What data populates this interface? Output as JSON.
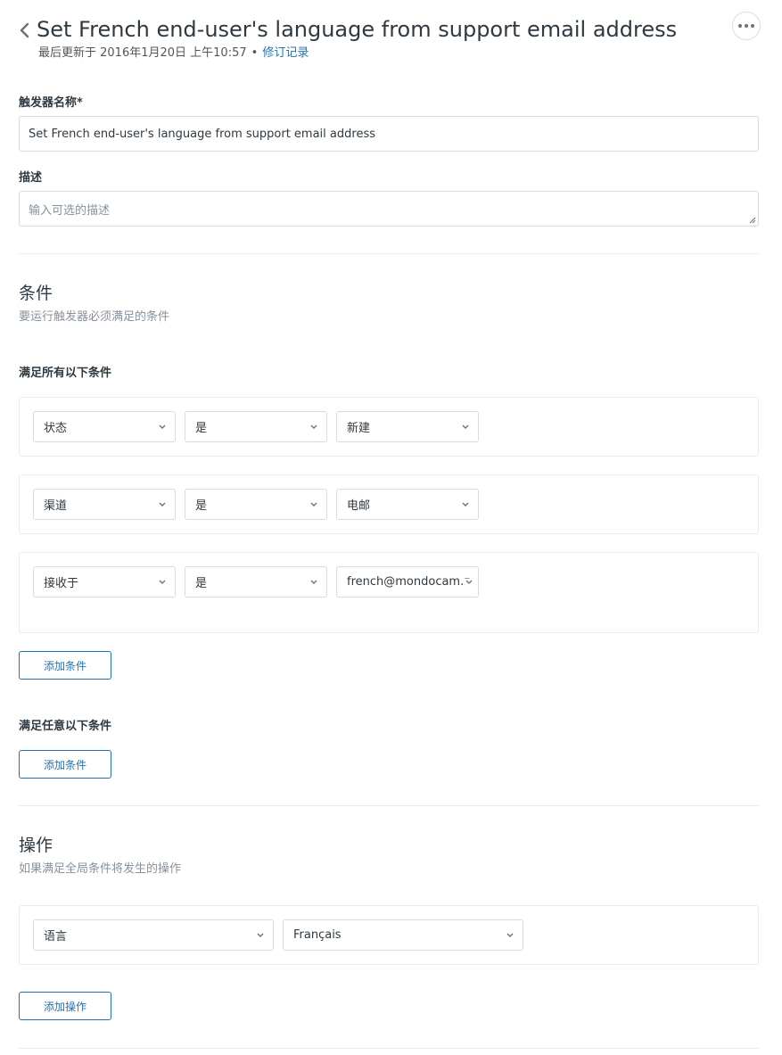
{
  "header": {
    "title": "Set French end-user's language from support email address",
    "updated_text": "最后更新于 2016年1月20日 上午10:57",
    "revisions_link": "修订记录"
  },
  "form": {
    "name_label": "触发器名称*",
    "name_value": "Set French end-user's language from support email address",
    "description_label": "描述",
    "description_placeholder": "输入可选的描述"
  },
  "conditions": {
    "title": "条件",
    "subtitle": "要运行触发器必须满足的条件",
    "all_label": "满足所有以下条件",
    "all_rows": [
      {
        "field": "状态",
        "operator": "是",
        "value": "新建"
      },
      {
        "field": "渠道",
        "operator": "是",
        "value": "电邮"
      },
      {
        "field": "接收于",
        "operator": "是",
        "value": "french@mondocam.z"
      }
    ],
    "add_condition_label": "添加条件",
    "any_label": "满足任意以下条件",
    "add_any_condition_label": "添加条件"
  },
  "actions": {
    "title": "操作",
    "subtitle": "如果满足全局条件将发生的操作",
    "rows": [
      {
        "field": "语言",
        "value": "Français"
      }
    ],
    "add_action_label": "添加操作"
  },
  "colors": {
    "accent": "#1f73b7",
    "border": "#d8dcde",
    "text": "#2f3941",
    "muted": "#87929d"
  }
}
